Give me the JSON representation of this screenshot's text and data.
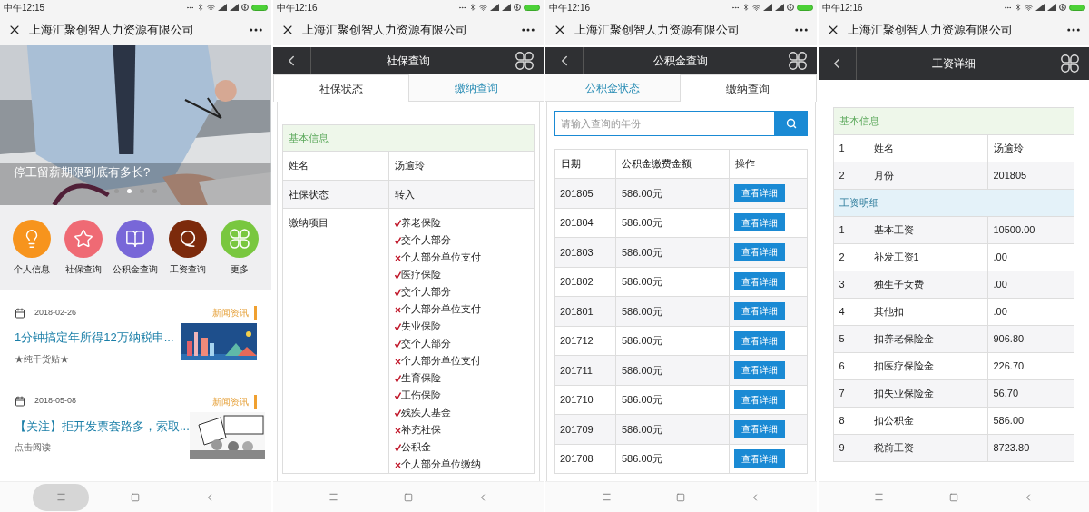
{
  "phones": [
    {
      "kind": "home",
      "time": "中午12:15",
      "title": "上海汇聚创智人力资源有限公司",
      "menu_pressed": true,
      "banner": {
        "caption": "停工留薪期限到底有多长?",
        "dots": [
          {
            "selected": false
          },
          {
            "selected": true
          },
          {
            "selected": false
          },
          {
            "selected": false
          }
        ]
      },
      "shortcuts": [
        {
          "label": "个人信息",
          "color": "#f7941d"
        },
        {
          "label": "社保查询",
          "color": "#ef6a74"
        },
        {
          "label": "公积金查询",
          "color": "#7867d8"
        },
        {
          "label": "工资查询",
          "color": "#7c2a0c"
        },
        {
          "label": "更多",
          "color": "#79c73f"
        }
      ],
      "news": [
        {
          "date": "2018-02-26",
          "tag": "新闻资讯",
          "title": "1分钟搞定年所得12万纳税申...",
          "summary": "★纯干货贴★"
        },
        {
          "date": "2018-05-08",
          "tag": "新闻资讯",
          "title": "【关注】拒开发票套路多，索取...",
          "summary": "点击阅读"
        }
      ]
    },
    {
      "kind": "social",
      "time": "中午12:16",
      "title": "上海汇聚创智人力资源有限公司",
      "menu_pressed": false,
      "page_title": "社保查询",
      "tabs": [
        {
          "label": "社保状态",
          "selected": true
        },
        {
          "label": "缴纳查询",
          "selected": false
        }
      ],
      "section": "基本信息",
      "rows": [
        {
          "label": "姓名",
          "value": "汤逾玲"
        },
        {
          "label": "社保状态",
          "value": "转入"
        },
        {
          "label": "缴纳项目",
          "items": [
            {
              "text": "养老保险",
              "checked": true
            },
            {
              "text": "交个人部分",
              "checked": true
            },
            {
              "text": "个人部分单位支付",
              "checked": false
            },
            {
              "text": "医疗保险",
              "checked": true
            },
            {
              "text": "交个人部分",
              "checked": true
            },
            {
              "text": "个人部分单位支付",
              "checked": false
            },
            {
              "text": "失业保险",
              "checked": true
            },
            {
              "text": "交个人部分",
              "checked": true
            },
            {
              "text": "个人部分单位支付",
              "checked": false
            },
            {
              "text": "生育保险",
              "checked": true
            },
            {
              "text": "工伤保险",
              "checked": true
            },
            {
              "text": "残疾人基金",
              "checked": true
            },
            {
              "text": "补充社保",
              "checked": false
            },
            {
              "text": "公积金",
              "checked": true
            },
            {
              "text": "个人部分单位缴纳",
              "checked": false
            }
          ]
        }
      ]
    },
    {
      "kind": "fund",
      "time": "中午12:16",
      "title": "上海汇聚创智人力资源有限公司",
      "menu_pressed": false,
      "page_title": "公积金查询",
      "tabs": [
        {
          "label": "公积金状态",
          "selected": false
        },
        {
          "label": "缴纳查询",
          "selected": true
        }
      ],
      "search": {
        "placeholder": "请输入查询的年份"
      },
      "columns": [
        "日期",
        "公积金缴费金额",
        "操作"
      ],
      "rows": [
        {
          "date": "201805",
          "amount": "586.00元",
          "action": "查看详细"
        },
        {
          "date": "201804",
          "amount": "586.00元",
          "action": "查看详细"
        },
        {
          "date": "201803",
          "amount": "586.00元",
          "action": "查看详细"
        },
        {
          "date": "201802",
          "amount": "586.00元",
          "action": "查看详细"
        },
        {
          "date": "201801",
          "amount": "586.00元",
          "action": "查看详细"
        },
        {
          "date": "201712",
          "amount": "586.00元",
          "action": "查看详细"
        },
        {
          "date": "201711",
          "amount": "586.00元",
          "action": "查看详细"
        },
        {
          "date": "201710",
          "amount": "586.00元",
          "action": "查看详细"
        },
        {
          "date": "201709",
          "amount": "586.00元",
          "action": "查看详细"
        },
        {
          "date": "201708",
          "amount": "586.00元",
          "action": "查看详细"
        }
      ]
    },
    {
      "kind": "salary",
      "time": "中午12:16",
      "title": "上海汇聚创智人力资源有限公司",
      "menu_pressed": false,
      "page_title": "工资详细",
      "sections": [
        {
          "kind": "basic",
          "title": "基本信息",
          "rows": [
            {
              "no": "1",
              "name": "姓名",
              "value": "汤逾玲"
            },
            {
              "no": "2",
              "name": "月份",
              "value": "201805"
            }
          ]
        },
        {
          "kind": "detail",
          "title": "工资明细",
          "rows": [
            {
              "no": "1",
              "name": "基本工资",
              "value": "10500.00"
            },
            {
              "no": "2",
              "name": "补发工资1",
              "value": ".00"
            },
            {
              "no": "3",
              "name": "独生子女费",
              "value": ".00"
            },
            {
              "no": "4",
              "name": "其他扣",
              "value": ".00"
            },
            {
              "no": "5",
              "name": "扣养老保险金",
              "value": "906.80"
            },
            {
              "no": "6",
              "name": "扣医疗保险金",
              "value": "226.70"
            },
            {
              "no": "7",
              "name": "扣失业保险金",
              "value": "56.70"
            },
            {
              "no": "8",
              "name": "扣公积金",
              "value": "586.00"
            },
            {
              "no": "9",
              "name": "税前工资",
              "value": "8723.80"
            }
          ]
        }
      ]
    }
  ]
}
